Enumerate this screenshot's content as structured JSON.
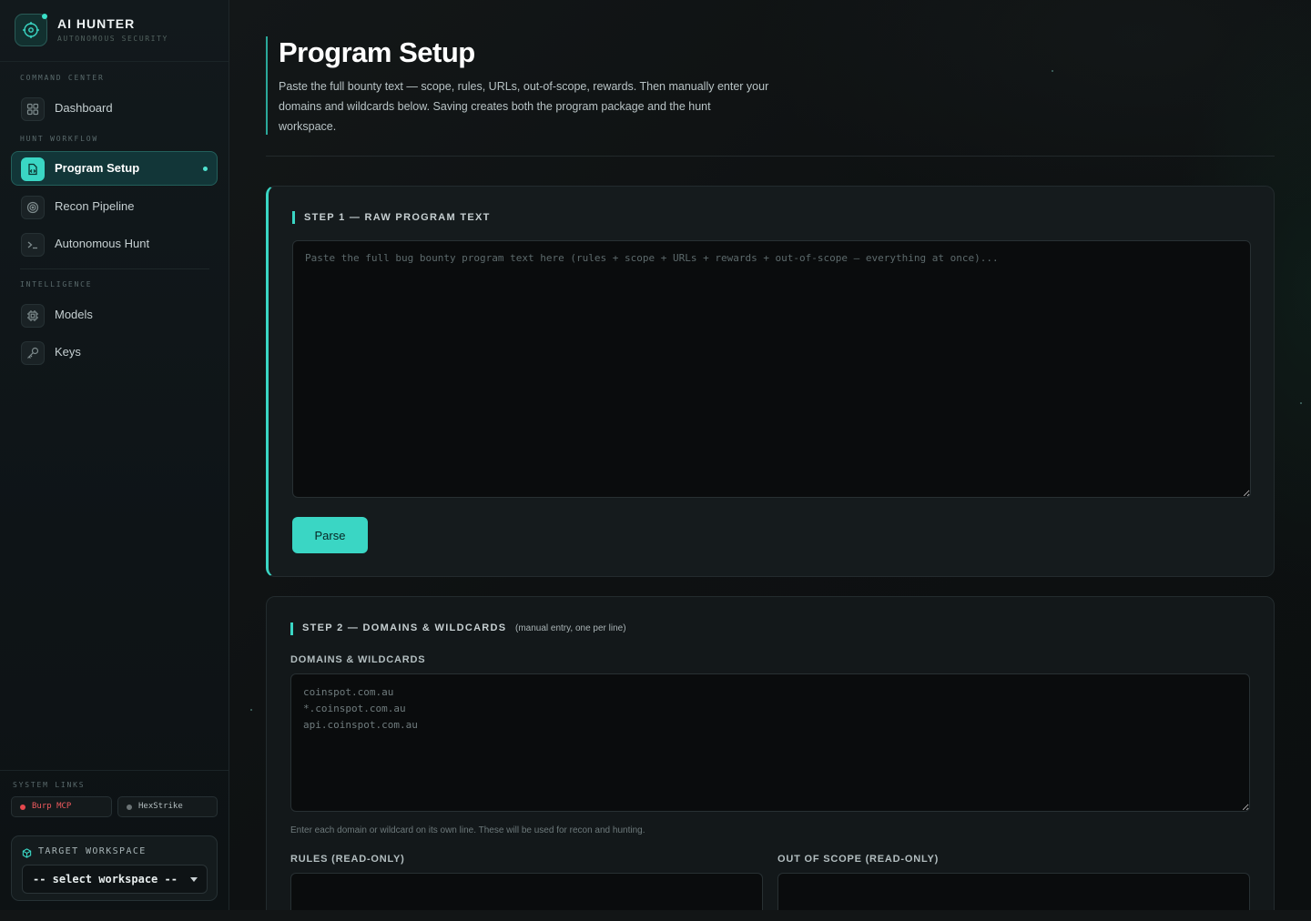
{
  "brand": {
    "title": "AI HUNTER",
    "subtitle": "AUTONOMOUS SECURITY"
  },
  "sidebar": {
    "sections": [
      {
        "label": "COMMAND CENTER"
      },
      {
        "label": "HUNT WORKFLOW"
      },
      {
        "label": "INTELLIGENCE"
      }
    ],
    "items": [
      {
        "label": "Dashboard",
        "icon": "grid-icon"
      },
      {
        "label": "Program Setup",
        "icon": "file-code-icon",
        "active": true
      },
      {
        "label": "Recon Pipeline",
        "icon": "radar-icon"
      },
      {
        "label": "Autonomous Hunt",
        "icon": "terminal-icon"
      },
      {
        "label": "Models",
        "icon": "chip-icon"
      },
      {
        "label": "Keys",
        "icon": "key-icon"
      }
    ],
    "system_links": {
      "label": "SYSTEM LINKS",
      "links": [
        {
          "label": "Burp MCP",
          "status": "offline",
          "color": "#e5484d"
        },
        {
          "label": "HexStrike",
          "status": "idle",
          "color": "#6b7375"
        }
      ]
    },
    "workspace": {
      "label": "TARGET WORKSPACE",
      "selected": "-- select workspace --"
    }
  },
  "page": {
    "title": "Program Setup",
    "description": "Paste the full bounty text — scope, rules, URLs, out-of-scope, rewards. Then manually enter your domains and wildcards below. Saving creates both the program package and the hunt workspace."
  },
  "step1": {
    "title": "STEP 1 — RAW PROGRAM TEXT",
    "placeholder": "Paste the full bug bounty program text here (rules + scope + URLs + rewards + out-of-scope — everything at once)...",
    "parse_label": "Parse"
  },
  "step2": {
    "title": "STEP 2 — DOMAINS & WILDCARDS",
    "note": "(manual entry, one per line)",
    "domains_label": "DOMAINS & WILDCARDS",
    "domains_placeholder": "coinspot.com.au\n*.coinspot.com.au\napi.coinspot.com.au",
    "hint": "Enter each domain or wildcard on its own line. These will be used for recon and hunting.",
    "rules_label": "RULES (READ-ONLY)",
    "out_of_scope_label": "OUT OF SCOPE (READ-ONLY)"
  },
  "colors": {
    "accent": "#3ad6c4",
    "background": "#0b0e10",
    "danger": "#e5484d"
  }
}
